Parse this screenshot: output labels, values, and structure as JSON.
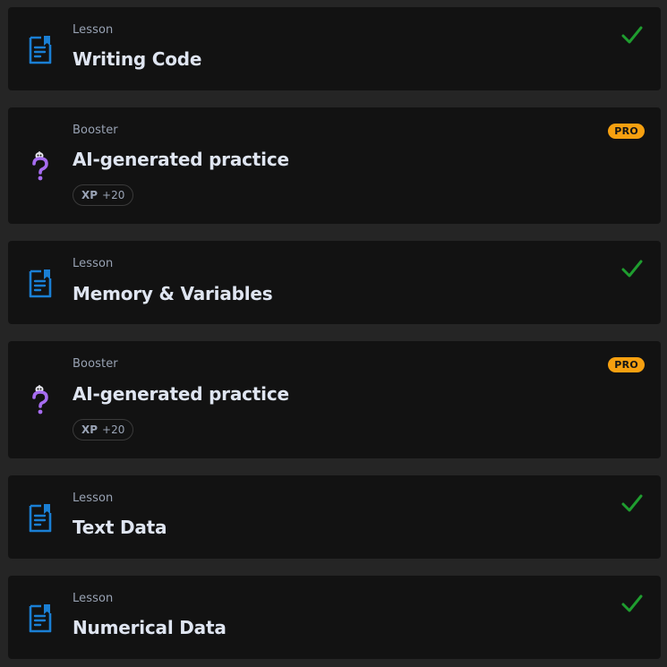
{
  "items": [
    {
      "type": "Lesson",
      "title": "Writing Code",
      "completed": true
    },
    {
      "type": "Booster",
      "title": "AI-generated practice",
      "badge": "PRO",
      "xp_label": "XP",
      "xp_value": "+20"
    },
    {
      "type": "Lesson",
      "title": "Memory & Variables",
      "completed": true
    },
    {
      "type": "Booster",
      "title": "AI-generated practice",
      "badge": "PRO",
      "xp_label": "XP",
      "xp_value": "+20"
    },
    {
      "type": "Lesson",
      "title": "Text Data",
      "completed": true
    },
    {
      "type": "Lesson",
      "title": "Numerical Data",
      "completed": true
    }
  ],
  "icons": {
    "lesson": "lesson-document-icon",
    "booster": "ai-question-icon",
    "completed": "checkmark-icon"
  },
  "colors": {
    "background": "#252525",
    "card": "#121212",
    "lesson_icon": "#1a7fd4",
    "booster_icon": "#a66cf0",
    "check": "#1f9d2f",
    "pro_badge": "#f6a010",
    "title": "#dfe5f1",
    "subtitle": "#98a2b3"
  }
}
